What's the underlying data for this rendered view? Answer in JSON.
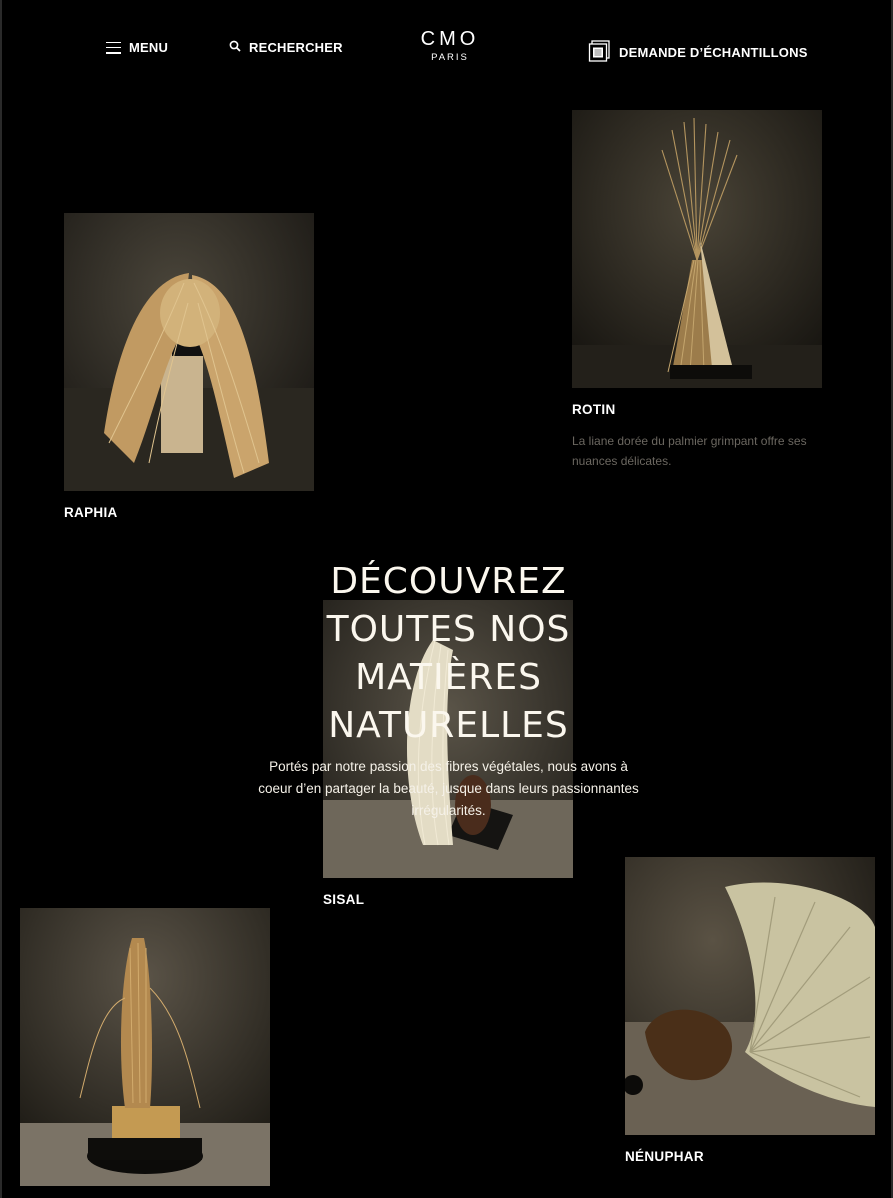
{
  "header": {
    "menu_label": "MENU",
    "search_label": "RECHERCHER",
    "logo_main": "CMO",
    "logo_sub": "PARIS",
    "samples_label": "DEMANDE D’ÉCHANTILLONS"
  },
  "hero": {
    "title_lines": [
      "DÉCOUVREZ",
      "TOUTES NOS",
      "MATIÈRES",
      "NATURELLES"
    ],
    "text": "Portés par notre passion des fibres végétales, nous avons à coeur d’en partager la beauté, jusque dans leurs passionnantes irrégularités."
  },
  "materials": {
    "rotin": {
      "name": "ROTIN",
      "description": "La liane dorée du palmier grimpant offre ses nuances délicates."
    },
    "raphia": {
      "name": "RAPHIA"
    },
    "sisal": {
      "name": "SISAL"
    },
    "coco": {
      "name": ""
    },
    "nenuphar": {
      "name": "NÉNUPHAR"
    }
  },
  "colors": {
    "background": "#000000",
    "text": "#f2efe8",
    "muted_text": "#6b6760"
  }
}
